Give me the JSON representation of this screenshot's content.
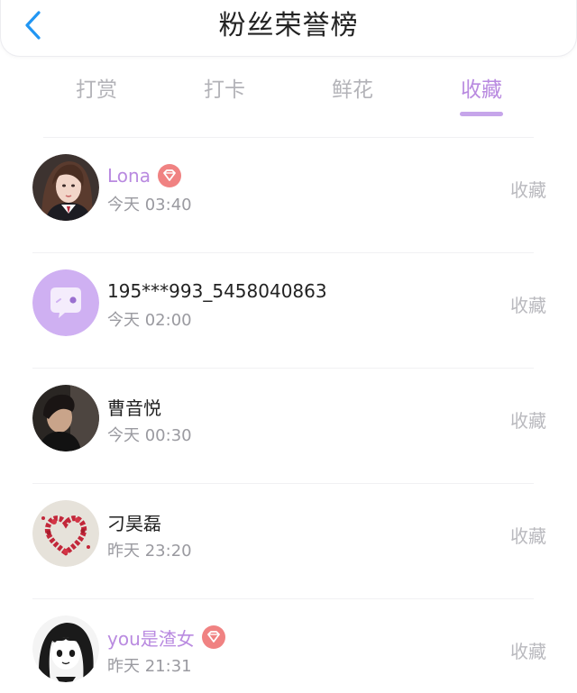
{
  "header": {
    "title": "粉丝荣誉榜",
    "back_icon": "chevron-left-icon"
  },
  "colors": {
    "accent": "#b98ae0",
    "text": "#222222",
    "muted": "#9a9aa0",
    "badge": "#f08282"
  },
  "tabs": [
    {
      "label": "打赏",
      "active": false
    },
    {
      "label": "打卡",
      "active": false
    },
    {
      "label": "鲜花",
      "active": false
    },
    {
      "label": "收藏",
      "active": true
    }
  ],
  "fans": [
    {
      "name": "Lona",
      "vip": true,
      "badge_icon": "diamond-badge-icon",
      "time": "今天 03:40",
      "action": "收藏",
      "avatar": "girl-portrait-avatar"
    },
    {
      "name": "195***993_5458040863",
      "vip": false,
      "time": "今天 02:00",
      "action": "收藏",
      "avatar": "default-chat-avatar"
    },
    {
      "name": "曹音悦",
      "vip": false,
      "time": "今天 00:30",
      "action": "收藏",
      "avatar": "boy-portrait-avatar"
    },
    {
      "name": "刁昊磊",
      "vip": false,
      "time": "昨天 23:20",
      "action": "收藏",
      "avatar": "rose-heart-avatar"
    },
    {
      "name": "you是渣女",
      "vip": true,
      "badge_icon": "diamond-badge-icon",
      "time": "昨天 21:31",
      "action": "收藏",
      "avatar": "anime-girl-avatar"
    }
  ]
}
